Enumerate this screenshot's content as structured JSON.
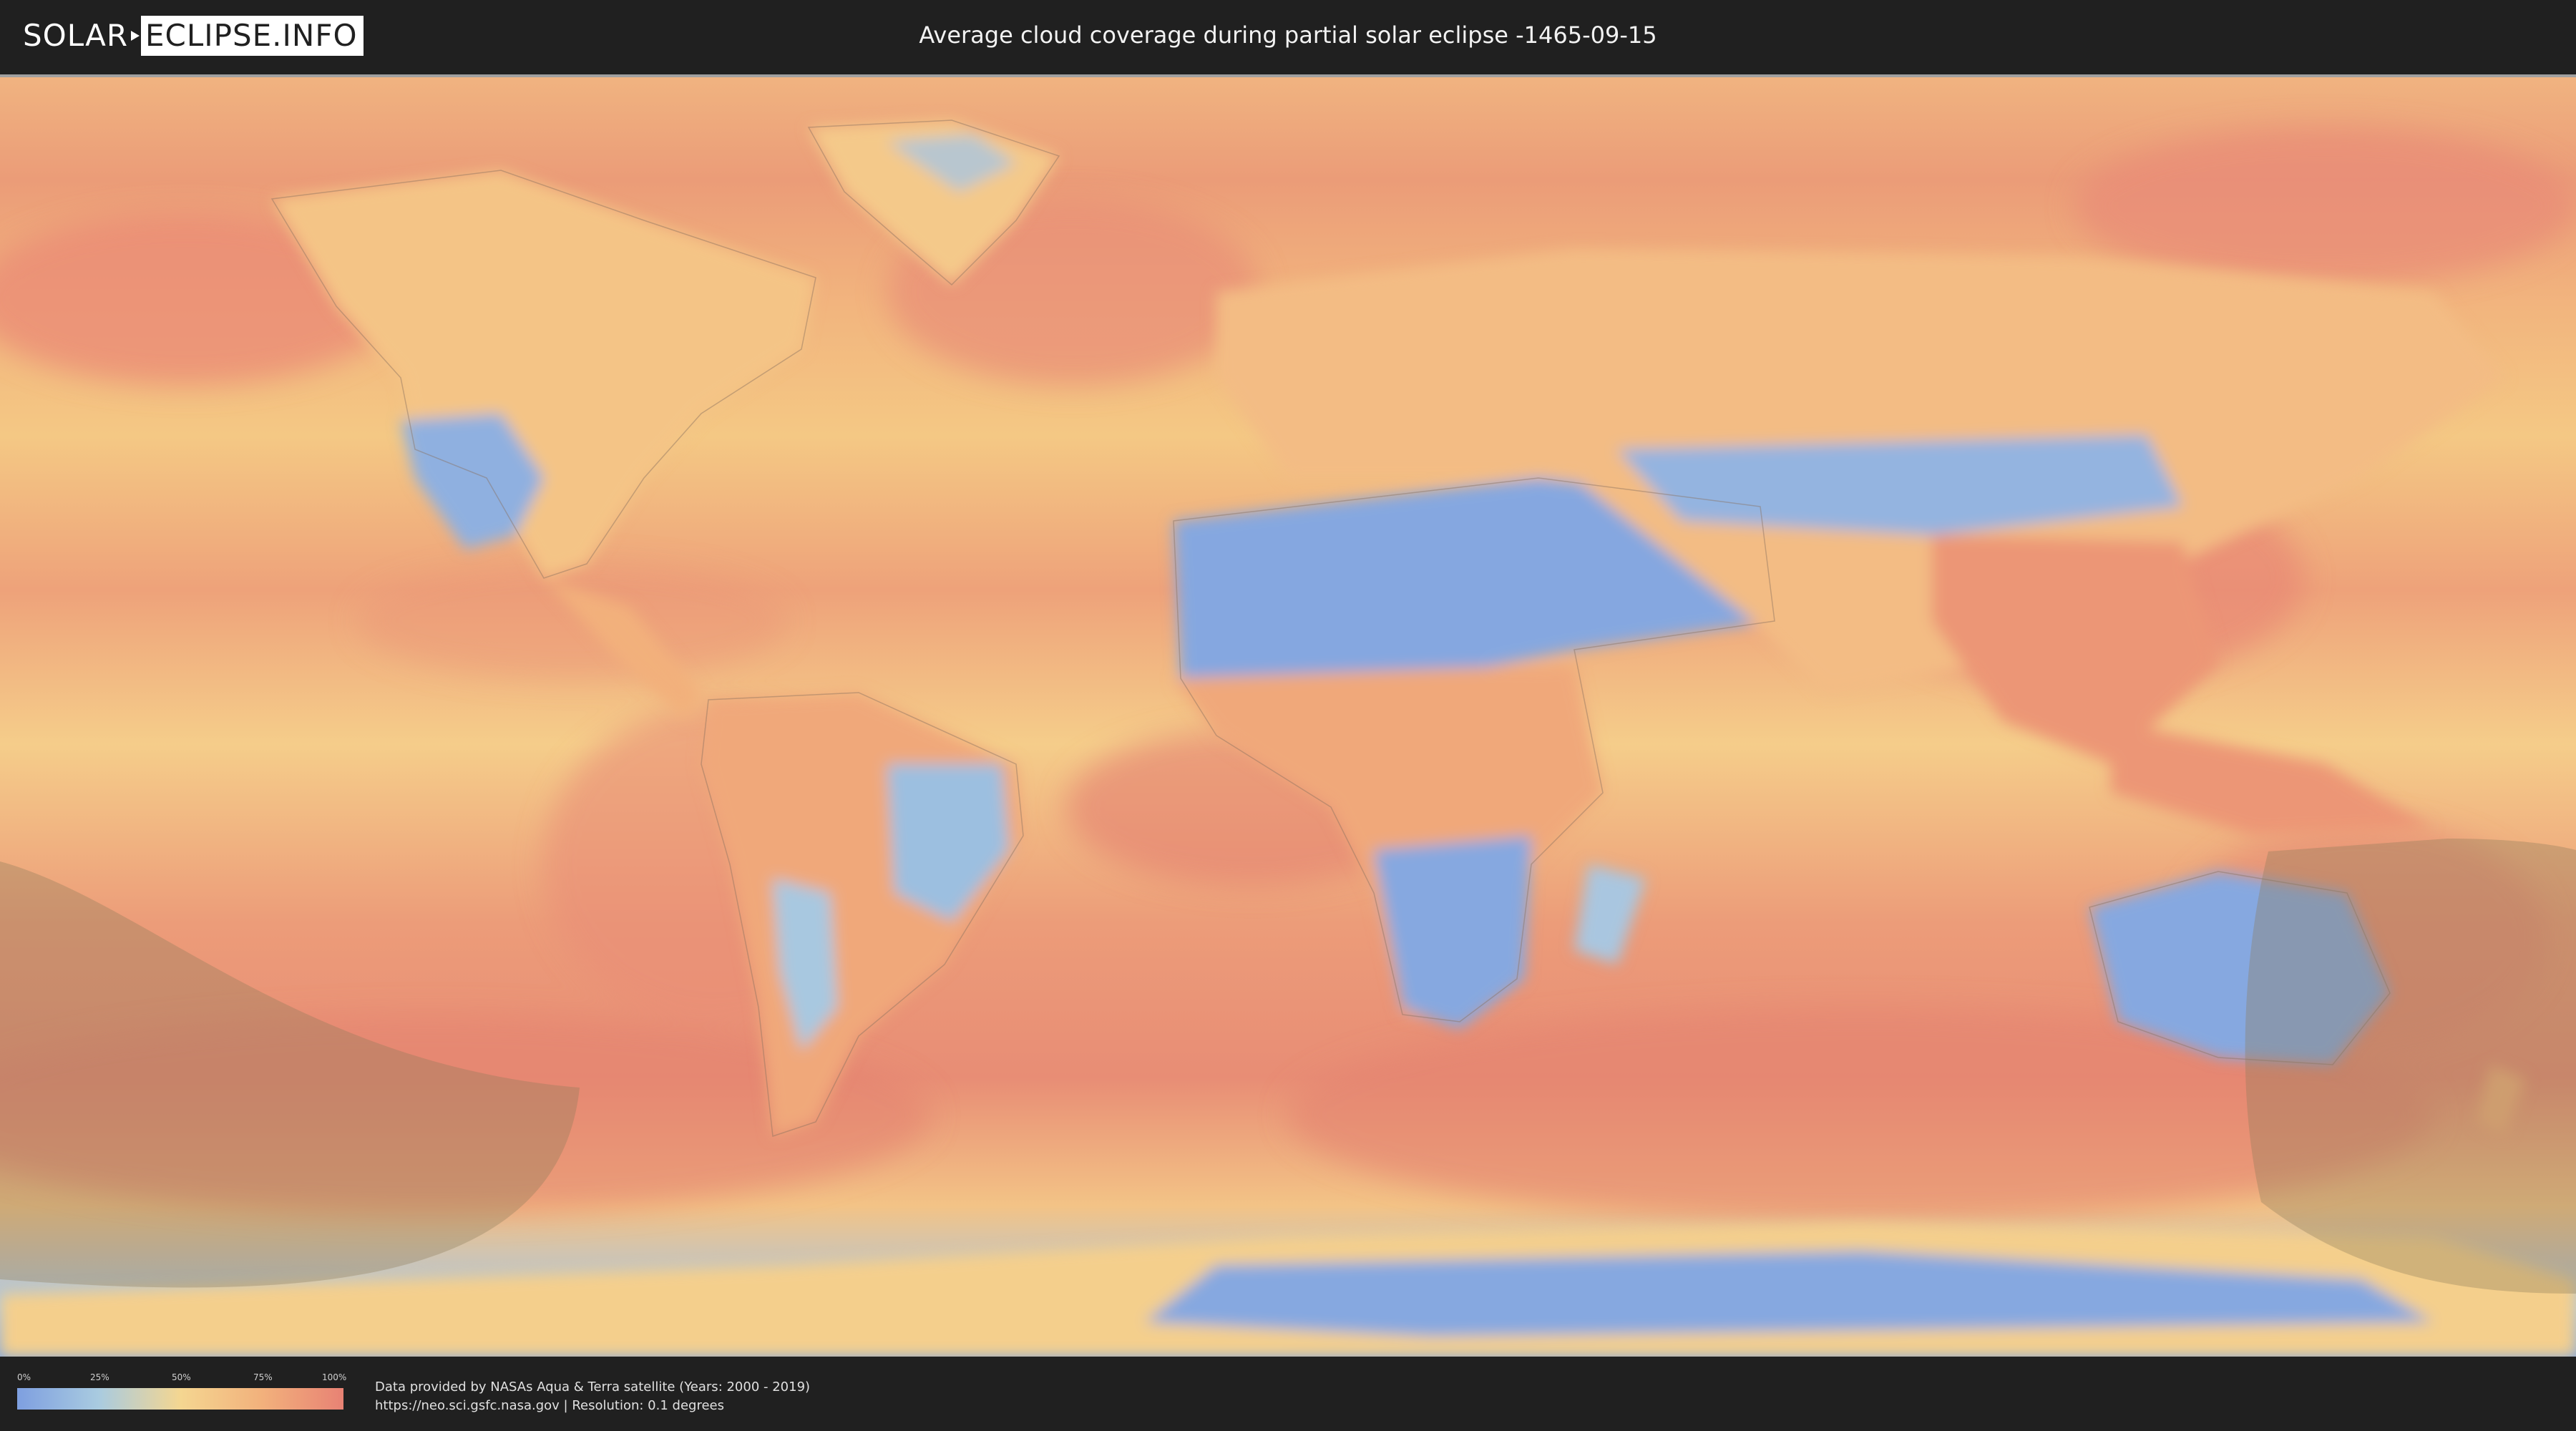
{
  "header": {
    "logo_solar": "SOLAR",
    "logo_eclipse": "ECLIPSE.INFO",
    "title": "Average cloud coverage during partial solar eclipse -1465-09-15"
  },
  "legend": {
    "ticks": [
      "0%",
      "25%",
      "50%",
      "75%",
      "100%"
    ],
    "colors": [
      "#7e9fe0",
      "#a9cbe0",
      "#f4d691",
      "#f2b17c",
      "#e88274"
    ]
  },
  "footer": {
    "credit_line1": "Data provided by NASAs Aqua & Terra satellite (Years: 2000 - 2019)",
    "credit_line2": "https://neo.sci.gsfc.nasa.gov | Resolution: 0.1 degrees"
  },
  "colors": {
    "background": "#202020",
    "clear_sky": "#7e9fe0",
    "overcast": "#e88274",
    "eclipse_overlay": "#8c7a5a"
  }
}
